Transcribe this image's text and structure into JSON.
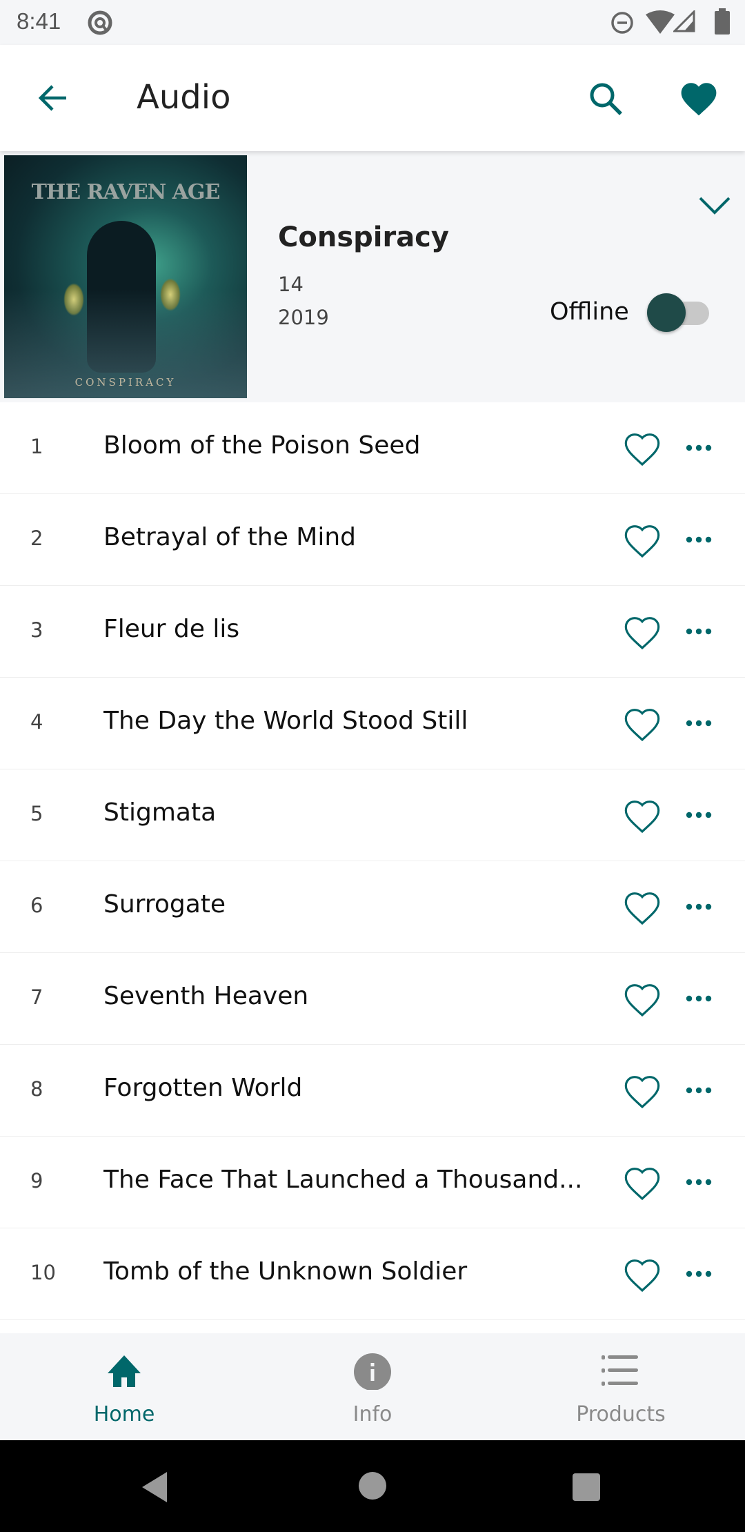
{
  "status_bar": {
    "time": "8:41",
    "icons": [
      "at-sign-icon",
      "do-not-disturb-icon",
      "wifi-icon",
      "signal-icon",
      "battery-icon"
    ]
  },
  "app_bar": {
    "title": "Audio",
    "back_icon": "arrow-left-icon",
    "search_icon": "search-icon",
    "favorite_icon": "heart-filled-icon"
  },
  "album": {
    "title": "Conspiracy",
    "track_count": "14",
    "year": "2019",
    "cover_text": "THE RAVEN AGE",
    "cover_subtitle": "CONSPIRACY",
    "offline_label": "Offline",
    "offline_enabled": true,
    "expand_icon": "chevron-down-icon"
  },
  "tracks": [
    {
      "number": "1",
      "title": "Bloom of the Poison Seed"
    },
    {
      "number": "2",
      "title": "Betrayal of the Mind"
    },
    {
      "number": "3",
      "title": "Fleur de lis"
    },
    {
      "number": "4",
      "title": "The Day the World Stood Still"
    },
    {
      "number": "5",
      "title": "Stigmata"
    },
    {
      "number": "6",
      "title": "Surrogate"
    },
    {
      "number": "7",
      "title": "Seventh Heaven"
    },
    {
      "number": "8",
      "title": "Forgotten World"
    },
    {
      "number": "9",
      "title": "The Face That Launched a Thousand..."
    },
    {
      "number": "10",
      "title": "Tomb of the Unknown Soldier"
    }
  ],
  "bottom_nav": [
    {
      "label": "Home",
      "icon": "home-icon",
      "active": true
    },
    {
      "label": "Info",
      "icon": "info-icon",
      "active": false
    },
    {
      "label": "Products",
      "icon": "list-icon",
      "active": false
    }
  ],
  "colors": {
    "accent": "#00676a",
    "inactive": "#8a8a8a",
    "toggle_thumb": "#1f4a48"
  }
}
